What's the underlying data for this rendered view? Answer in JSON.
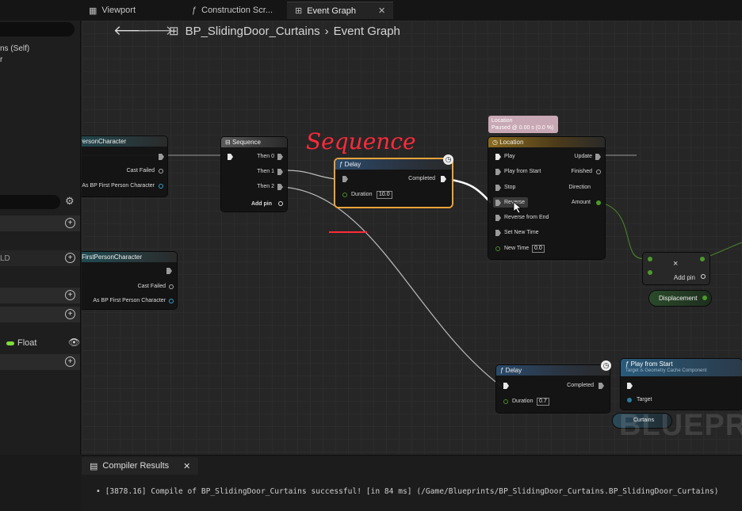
{
  "tabs": [
    {
      "label": "Viewport"
    },
    {
      "label": "Construction Scr..."
    },
    {
      "label": "Event Graph"
    }
  ],
  "left_panel": {
    "self_text": "ns (Self)",
    "row_ld": "LD",
    "float_label": "Float"
  },
  "breadcrumb": {
    "blueprint": "BP_SlidingDoor_Curtains",
    "graph": "Event Graph"
  },
  "annotation": {
    "text": "Sequence"
  },
  "nodes": {
    "cast1": {
      "title": "irstPersonCharacter",
      "cast_failed": "Cast Failed",
      "as_label": "As BP First Person Character"
    },
    "cast2": {
      "title": "FirstPersonCharacter",
      "cast_failed": "Cast Failed",
      "as_label": "As BP First Person Character"
    },
    "sequence": {
      "title": "Sequence",
      "then0": "Then 0",
      "then1": "Then 1",
      "then2": "Then 2",
      "add_pin": "Add pin"
    },
    "delay1": {
      "title": "Delay",
      "completed": "Completed",
      "duration_label": "Duration",
      "duration_value": "10.0"
    },
    "timeline": {
      "comment_line1": "Location",
      "comment_line2": "Paused @ 0.00 s (0.0 %)",
      "title": "Location",
      "inputs": [
        "Play",
        "Play from Start",
        "Stop",
        "Reverse",
        "Reverse from End",
        "Set New Time",
        "New Time"
      ],
      "new_time_value": "0.0",
      "outputs": [
        "Update",
        "Finished",
        "Direction",
        "Amount"
      ]
    },
    "multiply": {
      "symbol": "×",
      "add_pin": "Add pin"
    },
    "displacement": {
      "label": "Displacement"
    },
    "delay2": {
      "title": "Delay",
      "completed": "Completed",
      "duration_label": "Duration",
      "duration_value": "0.7"
    },
    "play_from_start": {
      "title": "Play from Start",
      "subtitle": "Target is Geometry Cache Component",
      "target_label": "Target"
    },
    "curtains": {
      "label": "Curtains"
    }
  },
  "watermark": "BLUEPR",
  "compiler": {
    "tab_label": "Compiler Results",
    "message": "[3878.16] Compile of BP_SlidingDoor_Curtains successful! [in 84 ms] (/Game/Blueprints/BP_SlidingDoor_Curtains.BP_SlidingDoor_Curtains)"
  },
  "colors": {
    "annotation": "#ff2a3a",
    "float_pin": "#7fdb3a",
    "delay_selected": "#e8a33a"
  }
}
